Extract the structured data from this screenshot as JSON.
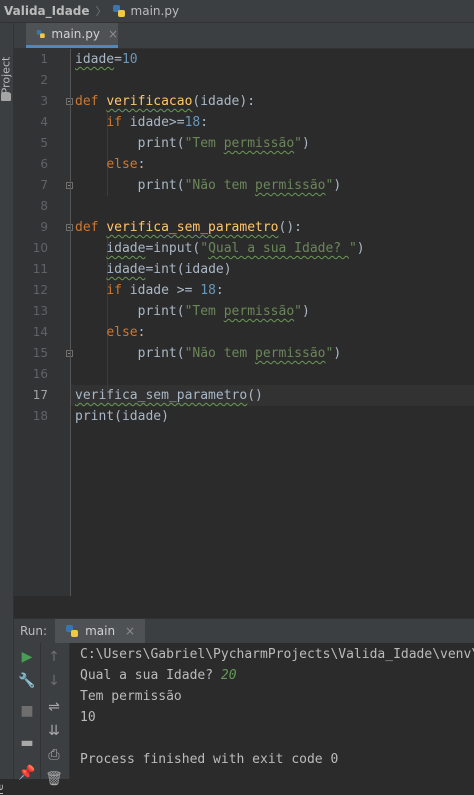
{
  "breadcrumb": {
    "project": "Valida_Idade",
    "file": "main.py"
  },
  "left_strip": {
    "project_tab": "Project",
    "structure_tab": "re"
  },
  "editor": {
    "tab": {
      "label": "main.py"
    },
    "line_numbers": [
      "1",
      "2",
      "3",
      "4",
      "5",
      "6",
      "7",
      "8",
      "9",
      "10",
      "11",
      "12",
      "13",
      "14",
      "15",
      "16",
      "17",
      "18"
    ],
    "current_line": 17
  },
  "run_panel": {
    "label": "Run:",
    "tab_label": "main",
    "output": {
      "path": "C:\\Users\\Gabriel\\PycharmProjects\\Valida_Idade\\venv\\S",
      "prompt": "Qual a sua Idade? ",
      "input_value": "20",
      "line3": "Tem permissão",
      "line4": "10",
      "line5": "",
      "line6": "Process finished with exit code 0"
    }
  },
  "colors": {
    "keyword": "#cc7832",
    "function": "#ffc66d",
    "string": "#6a8759",
    "number": "#6897bb",
    "text": "#a9b7c6"
  }
}
